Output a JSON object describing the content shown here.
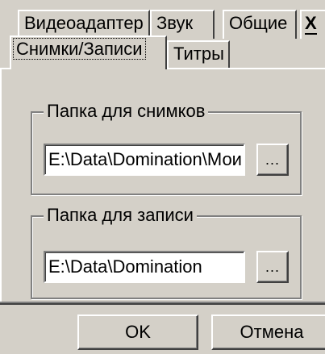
{
  "tabs_back": [
    {
      "label": "Видеоадаптер"
    },
    {
      "label": "Звук"
    },
    {
      "label": "Общие"
    },
    {
      "label": "X"
    }
  ],
  "tabs_front": [
    {
      "label": "Снимки/Записи",
      "active": true
    },
    {
      "label": "Титры",
      "active": false
    }
  ],
  "screenshots_group": {
    "legend": "Папка для снимков",
    "path_value": "E:\\Data\\Domination\\Мои",
    "browse_label": "..."
  },
  "recordings_group": {
    "legend": "Папка для записи",
    "path_value": "E:\\Data\\Domination",
    "browse_label": "..."
  },
  "footer": {
    "ok_label": "OK",
    "cancel_label": "Отмена"
  }
}
